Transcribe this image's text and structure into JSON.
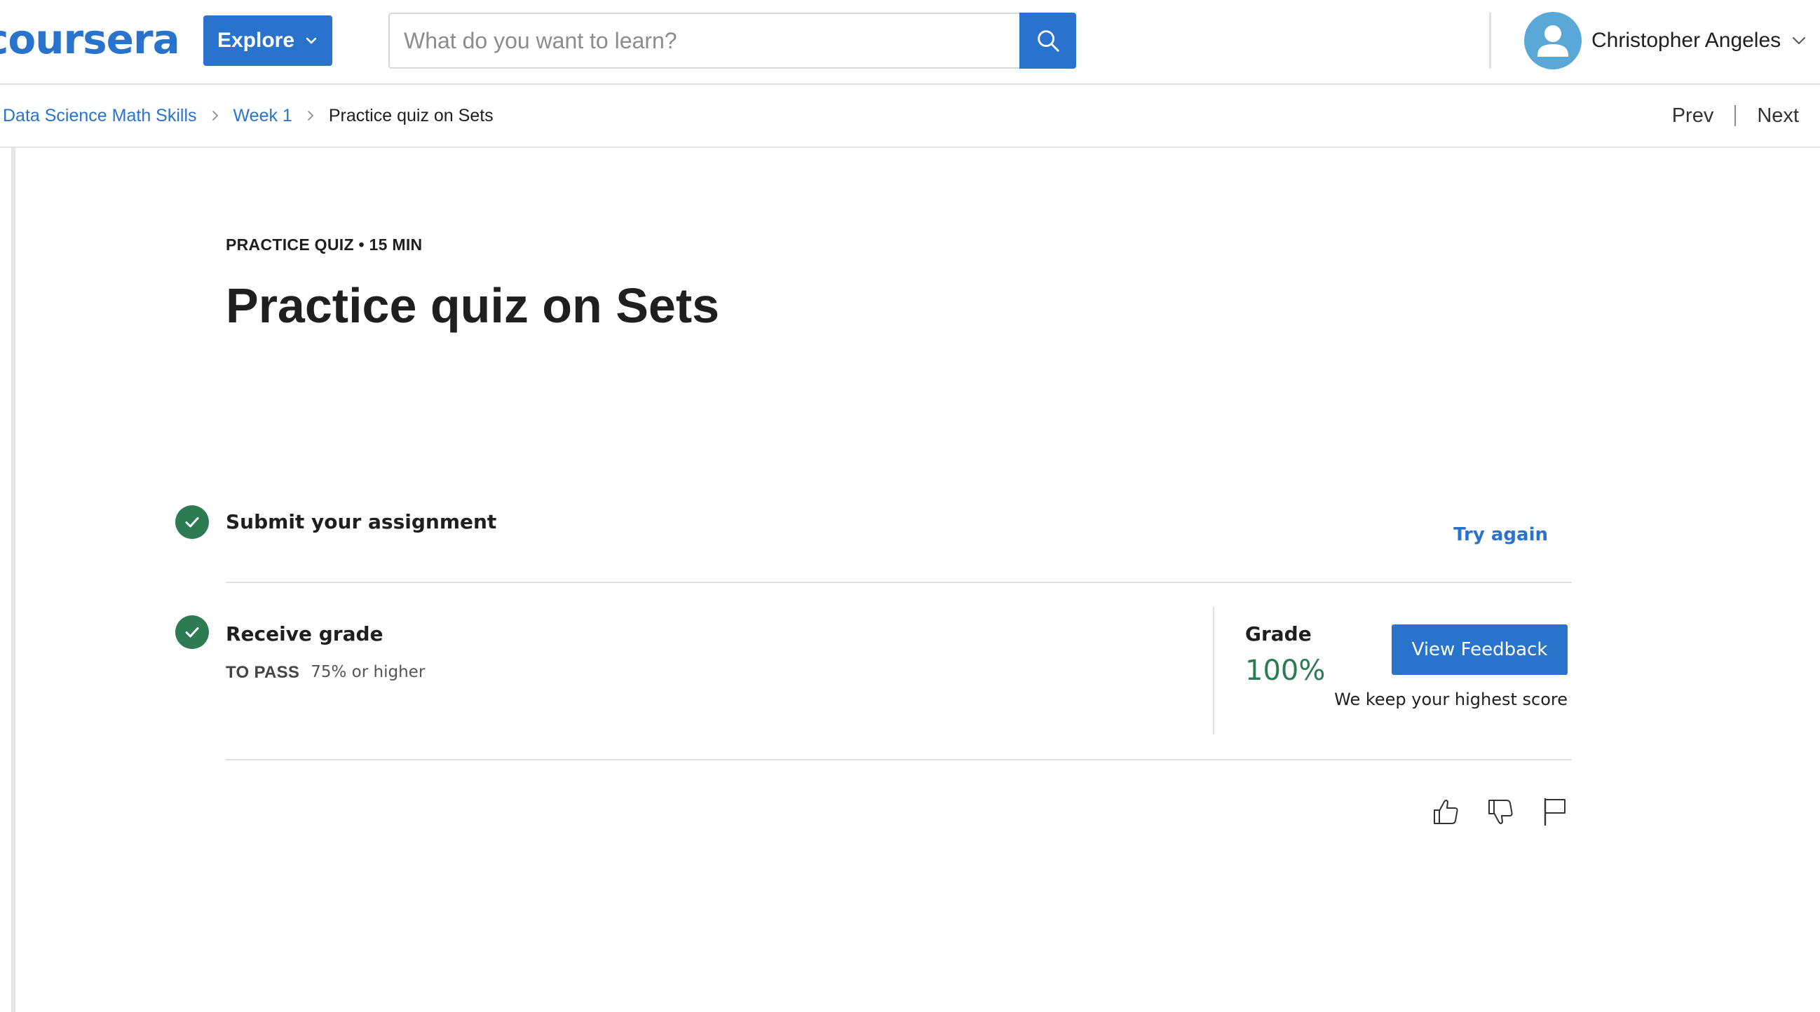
{
  "header": {
    "logo_text": "coursera",
    "explore_label": "Explore",
    "search_placeholder": "What do you want to learn?",
    "user_name": "Christopher Angeles"
  },
  "breadcrumb": {
    "items": [
      {
        "label": "Data Science Math Skills"
      },
      {
        "label": "Week 1"
      },
      {
        "label": "Practice quiz on Sets"
      }
    ],
    "prev_label": "Prev",
    "next_label": "Next"
  },
  "quiz": {
    "eyebrow": "PRACTICE QUIZ • 15 MIN",
    "title": "Practice quiz on Sets"
  },
  "steps": {
    "submit": {
      "title": "Submit your assignment",
      "action_label": "Try again"
    },
    "receive": {
      "title": "Receive grade",
      "to_pass_label": "TO PASS",
      "to_pass_value": "75% or higher"
    }
  },
  "grade": {
    "label": "Grade",
    "value": "100%",
    "button_label": "View Feedback",
    "note": "We keep your highest score"
  },
  "icons": {
    "search": "search-icon",
    "explore_chevron": "chevron-down-icon",
    "avatar": "user-avatar-icon",
    "user_chevron": "chevron-down-icon",
    "breadcrumb_separator": "chevron-right-icon",
    "step_done": "check-circle-icon",
    "like": "thumbs-up-icon",
    "dislike": "thumbs-down-icon",
    "report": "flag-icon"
  },
  "colors": {
    "brand": "#2a73cc",
    "success": "#2d7b53",
    "avatar_bg": "#5aa8d8"
  }
}
